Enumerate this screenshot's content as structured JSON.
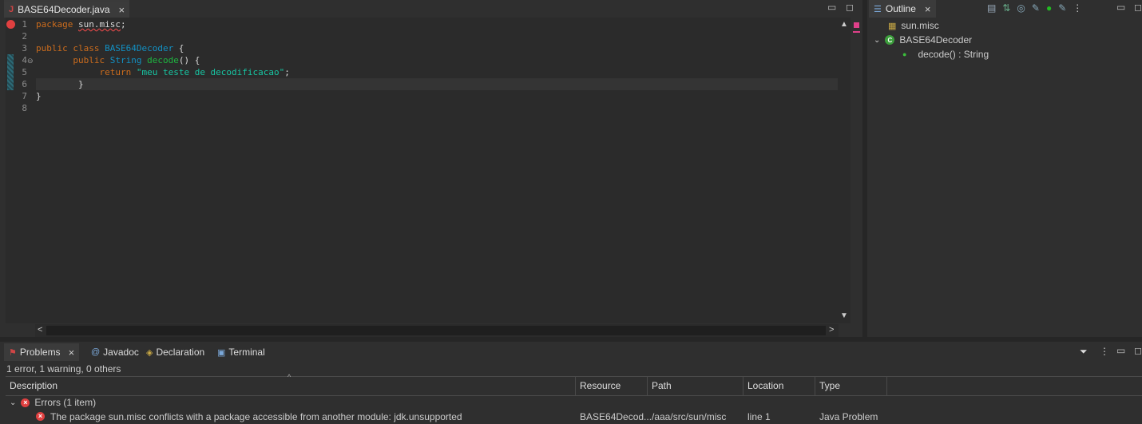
{
  "editor": {
    "tab_label": "BASE64Decoder.java",
    "lines": [
      {
        "no": "1",
        "parts": [
          {
            "t": "package ",
            "c": "kw"
          },
          {
            "t": "sun.misc",
            "c": "pkg"
          },
          {
            "t": ";",
            "c": ""
          }
        ]
      },
      {
        "no": "2",
        "parts": []
      },
      {
        "no": "3",
        "parts": [
          {
            "t": "public class ",
            "c": "kw"
          },
          {
            "t": "BASE64Decoder",
            "c": "cls"
          },
          {
            "t": " {",
            "c": ""
          }
        ]
      },
      {
        "no": "4",
        "parts": [
          {
            "t": "       public ",
            "c": "kw"
          },
          {
            "t": "String ",
            "c": "cls"
          },
          {
            "t": "decode",
            "c": "fn"
          },
          {
            "t": "() {",
            "c": ""
          }
        ]
      },
      {
        "no": "5",
        "parts": [
          {
            "t": "            return ",
            "c": "kw"
          },
          {
            "t": "\"meu teste de decodificacao\"",
            "c": "str"
          },
          {
            "t": ";",
            "c": ""
          }
        ]
      },
      {
        "no": "6",
        "parts": [
          {
            "t": "        }",
            "c": ""
          }
        ]
      },
      {
        "no": "7",
        "parts": [
          {
            "t": "}",
            "c": ""
          }
        ]
      },
      {
        "no": "8",
        "parts": []
      }
    ]
  },
  "outline": {
    "tab_label": "Outline",
    "items": [
      {
        "label": "sun.misc"
      },
      {
        "label": "BASE64Decoder"
      },
      {
        "label": "decode() : String"
      }
    ]
  },
  "bottom": {
    "tabs": [
      {
        "label": "Problems"
      },
      {
        "label": "Javadoc"
      },
      {
        "label": "Declaration"
      },
      {
        "label": "Terminal"
      }
    ],
    "summary": "1 error, 1 warning, 0 others",
    "columns": [
      "Description",
      "Resource",
      "Path",
      "Location",
      "Type"
    ],
    "group_label": "Errors (1 item)",
    "row": {
      "description": "The package sun.misc conflicts with a package accessible from another module: jdk.unsupported",
      "resource": "BASE64Decod...",
      "path": "/aaa/src/sun/misc",
      "location": "line 1",
      "type": "Java Problem"
    }
  },
  "colors": {
    "keyword": "#cc6c1d",
    "class": "#1290c3",
    "method": "#1eb540",
    "string": "#17c6a3",
    "error": "#e04040"
  }
}
